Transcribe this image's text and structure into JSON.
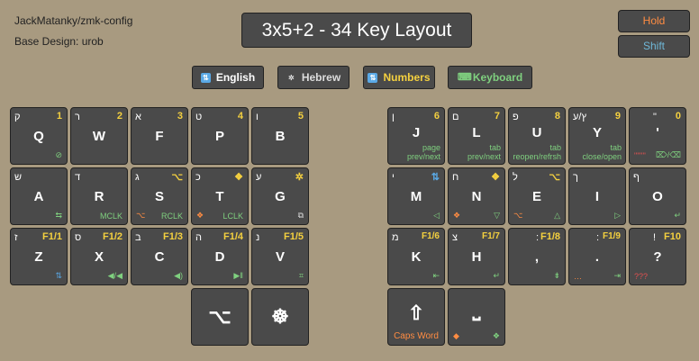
{
  "header": {
    "repo": "JackMatanky/zmk-config",
    "base_design": "Base Design: urob",
    "title": "3x5+2 - 34 Key Layout"
  },
  "side_buttons": {
    "hold": "Hold",
    "shift": "Shift"
  },
  "layers": [
    {
      "label": "English",
      "icon": "⇅",
      "color": "#ffffff"
    },
    {
      "label": "Hebrew",
      "icon": "✲",
      "color": "#dddddd"
    },
    {
      "label": "Numbers",
      "icon": "⇅",
      "color": "#f4d03f"
    },
    {
      "label": "Keyboard",
      "icon": "⌨",
      "color": "#7fd07f"
    }
  ],
  "keys": {
    "q": {
      "main": "Q",
      "heb": "ק",
      "num": "1",
      "br": "⊘"
    },
    "w": {
      "main": "W",
      "heb": "ר",
      "num": "2"
    },
    "f": {
      "main": "F",
      "heb": "א",
      "num": "3"
    },
    "p": {
      "main": "P",
      "heb": "ט",
      "num": "4"
    },
    "b": {
      "main": "B",
      "heb": "ו",
      "num": "5"
    },
    "j": {
      "main": "J",
      "heb": "ן",
      "num": "6",
      "small": "page\nprev/next"
    },
    "l": {
      "main": "L",
      "heb": "ם",
      "num": "7",
      "small": "tab\nprev/next"
    },
    "u": {
      "main": "U",
      "heb": "פ",
      "num": "8",
      "small": "tab\nreopen/refrsh"
    },
    "y": {
      "main": "Y",
      "heb": "ץ/ע",
      "num": "9",
      "small": "tab\nclose/open"
    },
    "apos": {
      "main": "'",
      "heb": "\"",
      "num": "0",
      "bl": "\"\"\"\"",
      "br": "⌦/⌫"
    },
    "a": {
      "main": "A",
      "heb": "ש",
      "br": "⇆"
    },
    "r": {
      "main": "R",
      "heb": "ד",
      "br": "MCLK"
    },
    "s": {
      "main": "S",
      "heb": "ג",
      "tr": "⌥",
      "bl": "⌥",
      "br": "RCLK"
    },
    "t": {
      "main": "T",
      "heb": "כ",
      "tr": "❖",
      "bl": "❖",
      "br": "LCLK"
    },
    "g": {
      "main": "G",
      "heb": "ע",
      "tr": "✲",
      "br": "⧉"
    },
    "m": {
      "main": "M",
      "heb": "י",
      "tr": "⇅",
      "br": "◁"
    },
    "n": {
      "main": "N",
      "heb": "ח",
      "tr": "❖",
      "bl": "❖",
      "br": "▽"
    },
    "e": {
      "main": "E",
      "heb": "ל",
      "tr": "⌥",
      "bl": "⌥",
      "br": "△"
    },
    "i": {
      "main": "I",
      "heb": "ך",
      "br": "▷"
    },
    "o": {
      "main": "O",
      "heb": "ף",
      "br": "↵"
    },
    "z": {
      "main": "Z",
      "heb": "ז",
      "num": "F1/1",
      "br": "⇅"
    },
    "x": {
      "main": "X",
      "heb": "ס",
      "num": "F1/2",
      "br": "◀/◀"
    },
    "c": {
      "main": "C",
      "heb": "ב",
      "num": "F1/3",
      "br": "◀)"
    },
    "d": {
      "main": "D",
      "heb": "ה",
      "num": "F1/4",
      "br": "▶‖"
    },
    "v": {
      "main": "V",
      "heb": "נ",
      "num": "F1/5",
      "br": "⌗"
    },
    "k": {
      "main": "K",
      "heb": "מ",
      "num": "F1/6",
      "br": "⇤"
    },
    "h": {
      "main": "H",
      "heb": "צ",
      "num": "F1/7",
      "br": "↵"
    },
    "comma": {
      "main": ",",
      "heb": ":",
      "num": "F1/8",
      "br": "⇟"
    },
    "dot": {
      "main": ".",
      "heb": ":",
      "num": "F1/9",
      "bl": "…",
      "br": "⇥"
    },
    "qmark": {
      "main": "?",
      "heb": "!",
      "num": "F10",
      "bl": "???"
    },
    "thumb_l1": {
      "main": "⌥"
    },
    "thumb_l2": {
      "main": "☸"
    },
    "thumb_r1": {
      "main": "⇧",
      "caption": "Caps Word"
    },
    "thumb_r2": {
      "main": "⎵",
      "bl": "◆",
      "br": "❖"
    }
  }
}
